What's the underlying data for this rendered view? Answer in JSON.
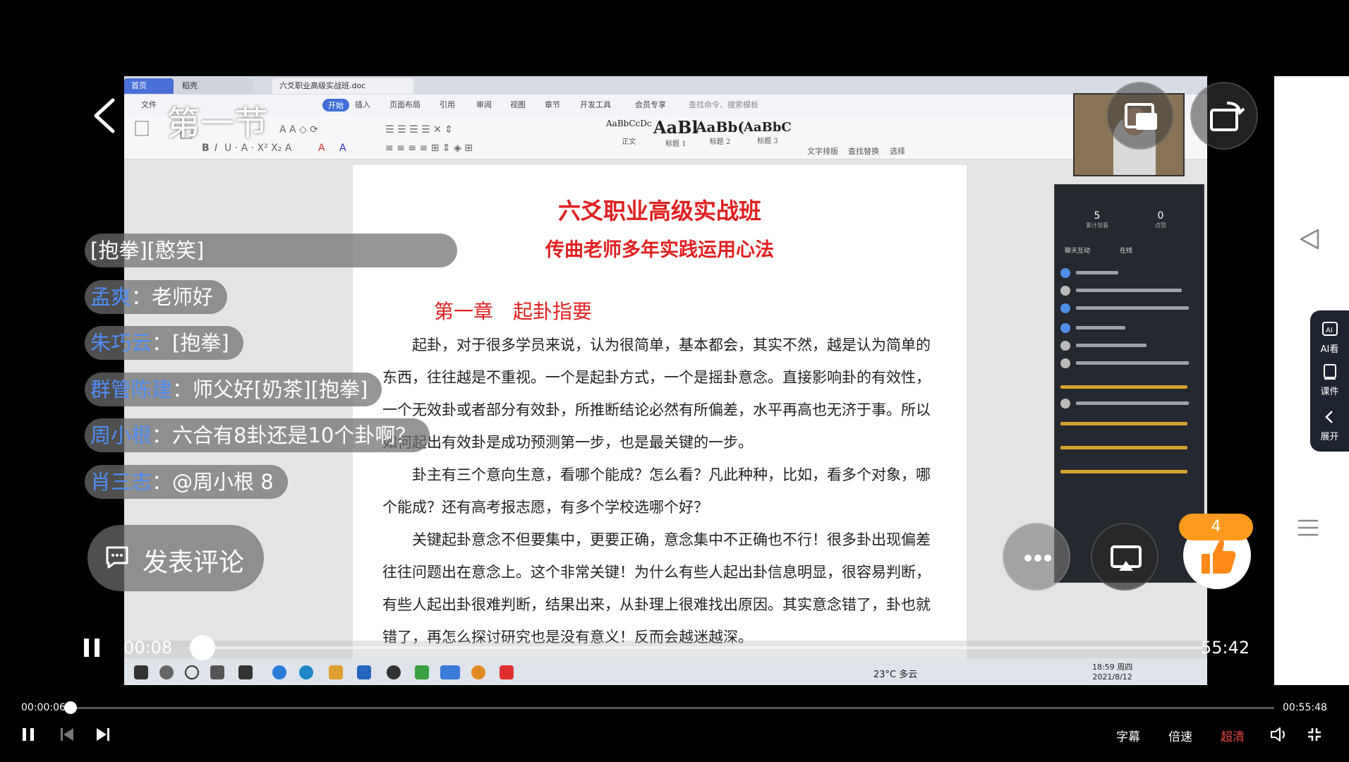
{
  "overlay": {
    "section_title": "第一节",
    "comment_button_label": "发表评论",
    "like_count": "4",
    "comments": [
      {
        "user": "",
        "text": "[抱拳][憨笑]"
      },
      {
        "user": "孟爽",
        "text": "老师好"
      },
      {
        "user": "朱巧云",
        "text": "[抱拳]"
      },
      {
        "user": "群管陈建",
        "text": "师父好[奶茶][抱拳]"
      },
      {
        "user": "周小根",
        "text": "六合有8卦还是10个卦啊？"
      },
      {
        "user": "肖三志",
        "text": "@周小根 8"
      }
    ]
  },
  "inner_player": {
    "current_time": "00:08",
    "duration": "55:42",
    "progress": 0.002
  },
  "side_panel": {
    "items": [
      {
        "label": "AI看",
        "icon": "ai-icon"
      },
      {
        "label": "课件",
        "icon": "courseware-icon"
      },
      {
        "label": "展开",
        "icon": "chevron-left-icon"
      }
    ]
  },
  "bottom_player": {
    "current_time": "00:00:06",
    "duration": "00:55:48",
    "progress": 0.002,
    "subtitle_label": "字幕",
    "speed_label": "倍速",
    "quality_label": "超清",
    "accent_color": "#4d8fe8",
    "quality_color": "#e84545"
  },
  "document": {
    "wps_tabs": [
      "首页",
      "稻壳",
      "六爻职业高级实战班.doc"
    ],
    "wps_menu": [
      "文件",
      "开始",
      "插入",
      "页面布局",
      "引用",
      "审阅",
      "视图",
      "章节",
      "开发工具",
      "会员专享",
      "查找命令、搜索模板"
    ],
    "styles": [
      {
        "preview": "AaBbCcDc",
        "name": "正文"
      },
      {
        "preview": "AaBl",
        "name": "标题 1"
      },
      {
        "preview": "AaBb(",
        "name": "标题 2"
      },
      {
        "preview": "AaBbC",
        "name": "标题 3"
      }
    ],
    "ribbon_right": [
      "文字排版",
      "查找替换",
      "选择"
    ],
    "title": "六爻职业高级实战班",
    "subtitle": "传曲老师多年实践运用心法",
    "chapter": "第一章　起卦指要",
    "paragraphs": [
      "起卦，对于很多学员来说，认为很简单，基本都会，其实不然，越是认为简单的东西，往往越是不重视。一个是起卦方式，一个是摇卦意念。直接影响卦的有效性，一个无效卦或者部分有效卦，所推断结论必然有所偏差，水平再高也无济于事。所以如何起出有效卦是成功预测第一步，也是最关键的一步。",
      "卦主有三个意向生意，看哪个能成？怎么看？凡此种种，比如，看多个对象，哪个能成？还有高考报志愿，有多个学校选哪个好？",
      "关键起卦意念不但要集中，更要正确，意念集中不正确也不行！很多卦出现偏差往往问题出在意念上。这个非常关键！为什么有些人起出卦信息明显，很容易判断，有些人起出卦很难判断，结果出来，从卦理上很难找出原因。其实意念错了，卦也就错了，再怎么探讨研究也是没有意义！反而会越迷越深。"
    ],
    "live_panel": {
      "stats": [
        {
          "value": "5",
          "label": "累计观看"
        },
        {
          "value": "0",
          "label": "点赞"
        }
      ],
      "tabs": [
        "聊天互动",
        "在线"
      ]
    },
    "taskbar": {
      "weather": "23°C 多云",
      "time": "18:59 周四",
      "date": "2021/8/12"
    }
  }
}
